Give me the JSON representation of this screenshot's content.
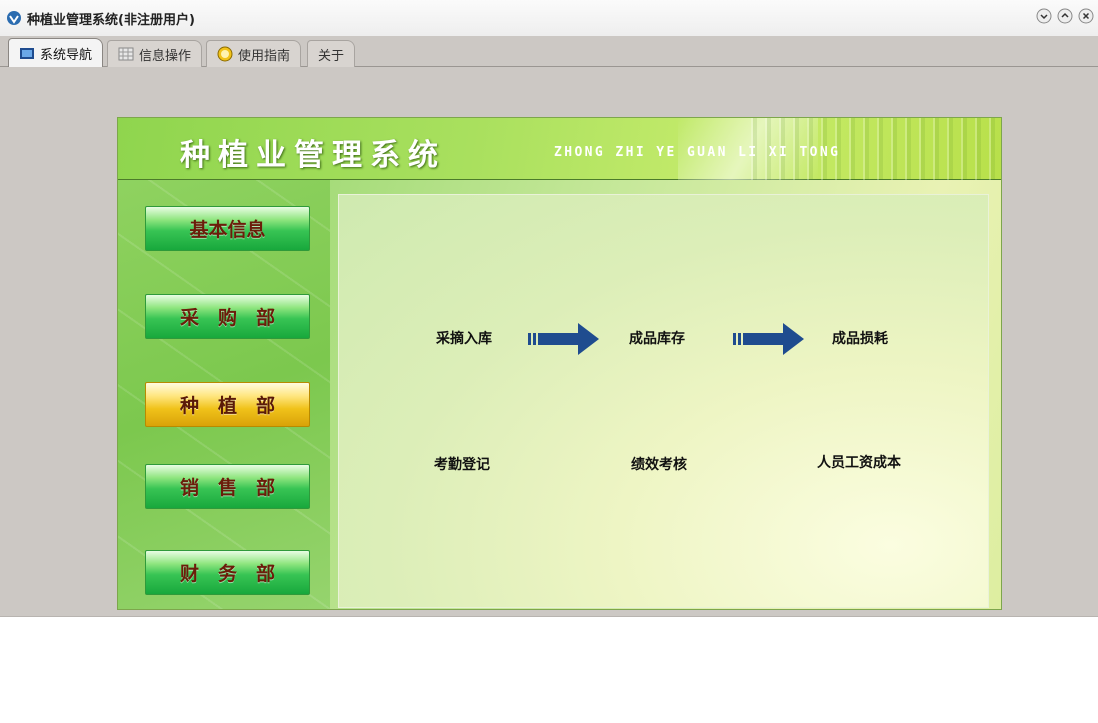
{
  "window": {
    "title": "种植业管理系统(非注册用户)",
    "icons": {
      "app": "app-logo-icon",
      "minimize": "chevron-down-icon",
      "maximize": "chevron-up-icon",
      "close": "close-icon"
    }
  },
  "tabs": [
    {
      "label": "系统导航",
      "icon": "monitor-icon",
      "active": true
    },
    {
      "label": "信息操作",
      "icon": "grid-icon",
      "active": false
    },
    {
      "label": "使用指南",
      "icon": "help-icon",
      "active": false
    },
    {
      "label": "关于",
      "icon": "",
      "active": false
    }
  ],
  "header": {
    "title": "种植业管理系统",
    "subtitle": "ZHONG ZHI YE GUAN LI XI TONG"
  },
  "sidebar": {
    "items": [
      {
        "label": "基本信息",
        "active": false
      },
      {
        "label": "采　购　部",
        "active": false
      },
      {
        "label": "种　植　部",
        "active": true
      },
      {
        "label": "销　售　部",
        "active": false
      },
      {
        "label": "财　务　部",
        "active": false
      }
    ]
  },
  "flow": {
    "row1": [
      "采摘入库",
      "成品库存",
      "成品损耗"
    ],
    "row2": [
      "考勤登记",
      "绩效考核",
      "人员工资成本"
    ],
    "arrow_icon": "right-arrow-icon"
  },
  "colors": {
    "header_green": "#a9e05e",
    "button_green": "#38c454",
    "button_active_yellow": "#f0c21a",
    "button_text": "#6b1d0a",
    "arrow_blue": "#1f4c8f"
  }
}
